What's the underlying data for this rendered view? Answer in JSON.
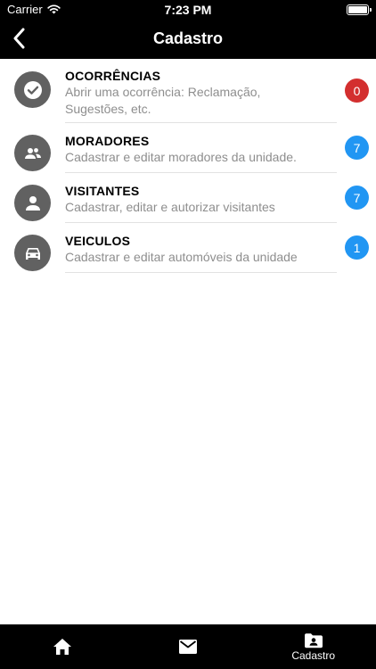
{
  "status_bar": {
    "carrier": "Carrier",
    "time": "7:23 PM"
  },
  "nav": {
    "title": "Cadastro"
  },
  "items": [
    {
      "label": "OCORRÊNCIAS",
      "desc_line1": "Abrir uma ocorrência: Reclamação,",
      "desc_line2": "Sugestões, etc.",
      "count": "0",
      "badge_color": "#d32f2f",
      "icon": "check-circle-icon"
    },
    {
      "label": "MORADORES",
      "desc_line1": "Cadastrar e editar moradores da unidade.",
      "count": "7",
      "badge_color": "#2196f3",
      "icon": "people-icon"
    },
    {
      "label": "VISITANTES",
      "desc_line1": "Cadastrar, editar e autorizar visitantes",
      "count": "7",
      "badge_color": "#2196f3",
      "icon": "person-icon"
    },
    {
      "label": "VEICULOS",
      "desc_line1": "Cadastrar e editar automóveis da unidade",
      "count": "1",
      "badge_color": "#2196f3",
      "icon": "car-icon"
    }
  ],
  "tabbar": {
    "tabs": [
      {
        "icon": "home-icon",
        "label": ""
      },
      {
        "icon": "mail-icon",
        "label": ""
      },
      {
        "icon": "contact-folder-icon",
        "label": "Cadastro"
      }
    ]
  }
}
